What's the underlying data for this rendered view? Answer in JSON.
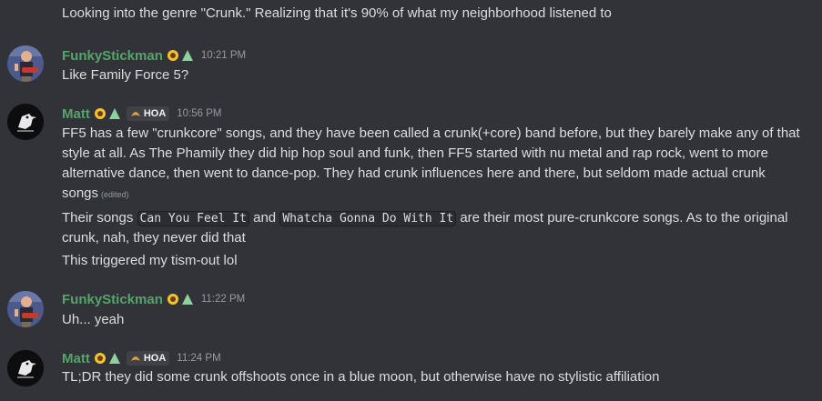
{
  "messages": [
    {
      "id": "m0",
      "text": "Looking into the genre \"Crunk.\" Realizing that it's 90% of what my neighborhood listened to"
    },
    {
      "id": "m1",
      "author": "FunkyStickman",
      "time": "10:21 PM",
      "text": "Like Family Force 5?"
    },
    {
      "id": "m2",
      "author": "Matt",
      "tag": "HOA",
      "time": "10:56 PM",
      "text": "FF5 has a few \"crunkcore\" songs, and they have been called a crunk(+core) band before, but they barely make any of that style at all. As The Phamily they did hip hop soul and funk, then FF5 started with nu metal and rap rock, went to more alternative dance, then went to dance-pop. They had crunk influences here and there, but seldom made actual crunk songs",
      "edited": "(edited)",
      "line2_pre": "Their songs ",
      "code1": "Can You Feel It",
      "line2_mid": " and ",
      "code2": "Whatcha Gonna Do With It",
      "line2_post": " are their most pure-crunkcore songs. As to the original",
      "line2_cont": "crunk, nah, they never did that",
      "line3": "This triggered my tism-out lol"
    },
    {
      "id": "m3",
      "author": "FunkyStickman",
      "time": "11:22 PM",
      "text": "Uh... yeah"
    },
    {
      "id": "m4",
      "author": "Matt",
      "tag": "HOA",
      "time": "11:24 PM",
      "text": "TL;DR they did some crunk offshoots once in a blue moon, but otherwise have no stylistic affiliation"
    }
  ],
  "colors": {
    "background": "#313338",
    "username": "#57a36b",
    "timestamp": "#949ba4",
    "text": "#dbdee1"
  },
  "icons": [
    "sunflower-icon",
    "tree-icon",
    "croissant-icon",
    "crow-avatar-icon",
    "guitarist-avatar"
  ]
}
